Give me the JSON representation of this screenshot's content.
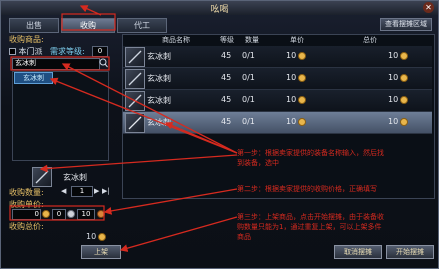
{
  "window": {
    "title": "吆喝"
  },
  "tabs": [
    "出售",
    "收购",
    "代工"
  ],
  "header_right_button": "查看摆摊区域",
  "left": {
    "purchase_goods_label": "收购商品:",
    "this_school_label": "本门派",
    "demand_level_label": "需求等级:",
    "demand_level_value": "0",
    "search_value": "玄冰刺",
    "result_item": "玄冰刺",
    "selected_item_name": "玄冰刺",
    "quantity_label": "收购数量:",
    "quantity_value": "1",
    "price_label": "收购单价:",
    "price_values": [
      "0",
      "0",
      "10"
    ],
    "total_label": "收购总价:",
    "total_value": "10",
    "list_button": "上架"
  },
  "table": {
    "headers": [
      "商品名称",
      "等级",
      "数量",
      "单价",
      "总价"
    ],
    "rows": [
      {
        "name": "玄冰刺",
        "level": "45",
        "qty": "0/1",
        "price": "10",
        "total": "10"
      },
      {
        "name": "玄冰刺",
        "level": "45",
        "qty": "0/1",
        "price": "10",
        "total": "10"
      },
      {
        "name": "玄冰刺",
        "level": "45",
        "qty": "0/1",
        "price": "10",
        "total": "10"
      },
      {
        "name": "玄冰刺",
        "level": "45",
        "qty": "0/1",
        "price": "10",
        "total": "10"
      }
    ]
  },
  "notes": {
    "step1": "第一步：根据卖家提供的装备名称输入，然后找到装备，选中",
    "step2": "第二步：根据卖家提供的收购价格，正确填写",
    "step3": "第三步：上架商品，点击开始摆摊，由于装备收购数量只能为1，通过重复上架，可以上架多件商品"
  },
  "buttons": {
    "cancel": "取消摆摊",
    "start": "开始摆摊"
  },
  "colors": {
    "annotation": "#d62a1f",
    "item_name": "#7ddc2f",
    "accent": "#e6c067"
  }
}
